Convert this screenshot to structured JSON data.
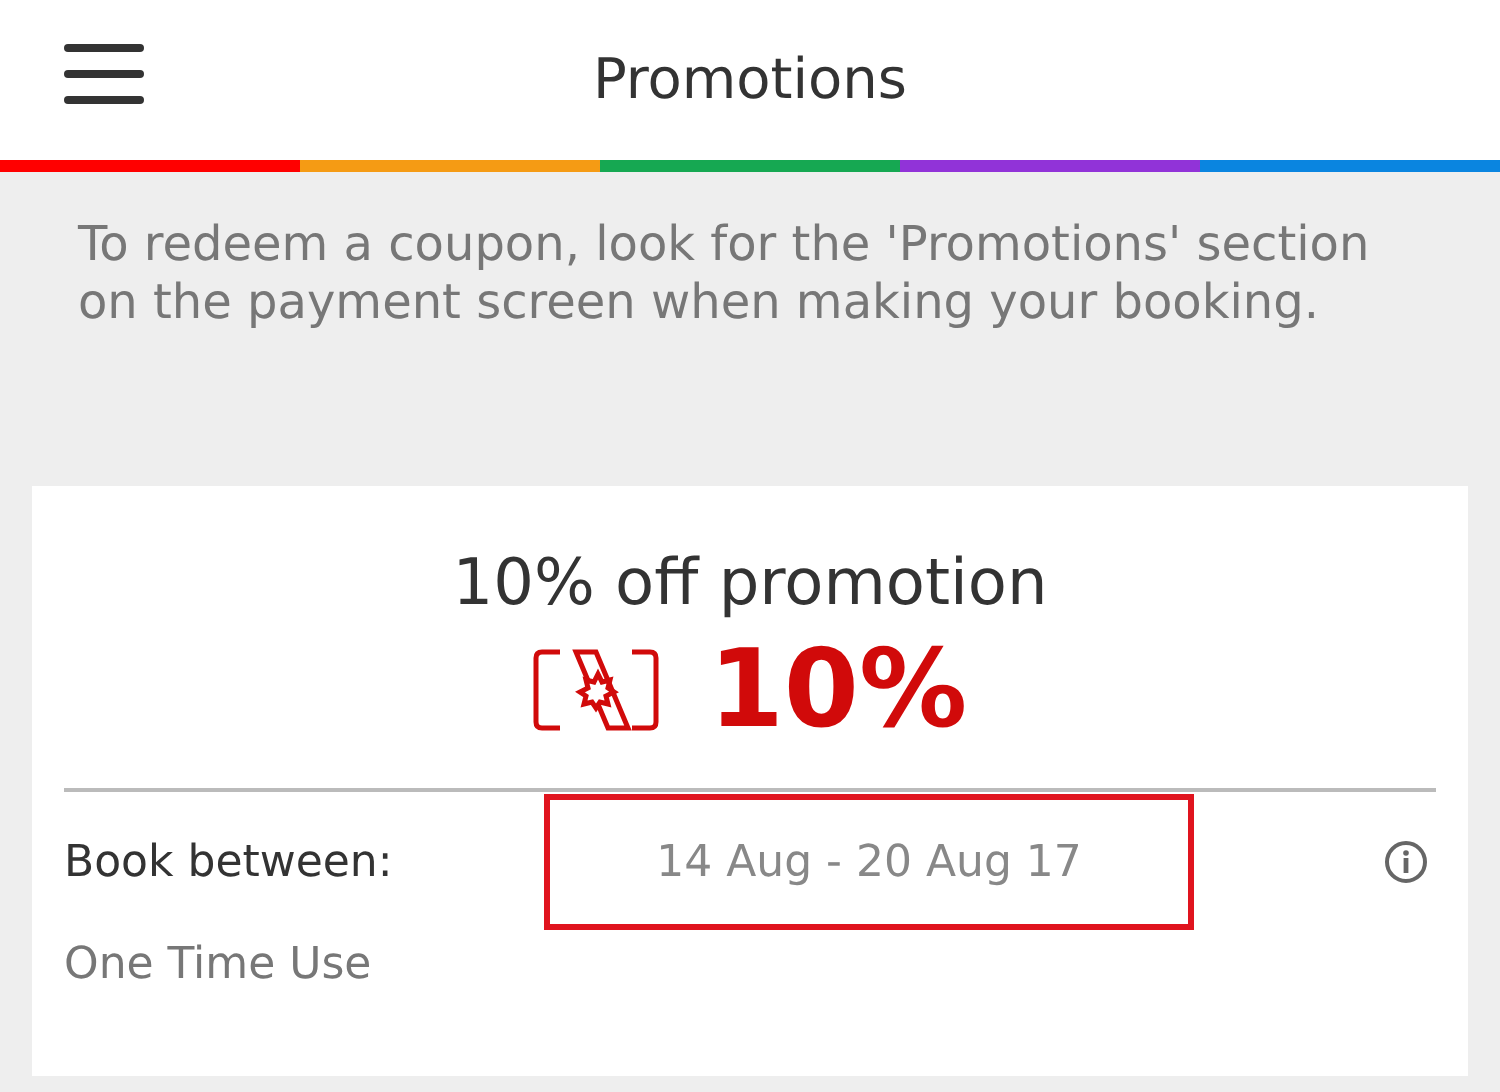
{
  "header": {
    "title": "Promotions"
  },
  "intro": "To redeem a coupon, look for the 'Promotions' section on the payment screen when making your booking.",
  "promotion": {
    "title": "10% off promotion",
    "discount": "10%",
    "book_between_label": "Book between:",
    "dates": "14 Aug - 20 Aug 17",
    "dates_highlighted": true,
    "usage": "One Time Use"
  }
}
